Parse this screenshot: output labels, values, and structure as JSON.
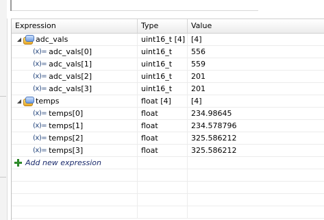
{
  "columns": {
    "expression": "Expression",
    "type": "Type",
    "value": "Value"
  },
  "rows": [
    {
      "name": "adc_vals",
      "type": "uint16_t [4]",
      "value": "[4]",
      "kind": "array",
      "expanded": true
    },
    {
      "name": "adc_vals[0]",
      "type": "uint16_t",
      "value": "556",
      "kind": "element"
    },
    {
      "name": "adc_vals[1]",
      "type": "uint16_t",
      "value": "559",
      "kind": "element"
    },
    {
      "name": "adc_vals[2]",
      "type": "uint16_t",
      "value": "201",
      "kind": "element"
    },
    {
      "name": "adc_vals[3]",
      "type": "uint16_t",
      "value": "201",
      "kind": "element"
    },
    {
      "name": "temps",
      "type": "float [4]",
      "value": "[4]",
      "kind": "array",
      "expanded": true
    },
    {
      "name": "temps[0]",
      "type": "float",
      "value": "234.98645",
      "kind": "element"
    },
    {
      "name": "temps[1]",
      "type": "float",
      "value": "234.578796",
      "kind": "element"
    },
    {
      "name": "temps[2]",
      "type": "float",
      "value": "325.586212",
      "kind": "element"
    },
    {
      "name": "temps[3]",
      "type": "float",
      "value": "325.586212",
      "kind": "element"
    }
  ],
  "add_expression": {
    "label": "Add new expression",
    "icon": "plus-icon"
  },
  "icons": {
    "array": "variable-array-icon",
    "element": "variable-element-icon",
    "expand": "expand-twistie-icon"
  },
  "colors": {
    "add_icon": "#3aa635",
    "add_text": "#1a2a6c",
    "element_icon": "#20427a"
  }
}
